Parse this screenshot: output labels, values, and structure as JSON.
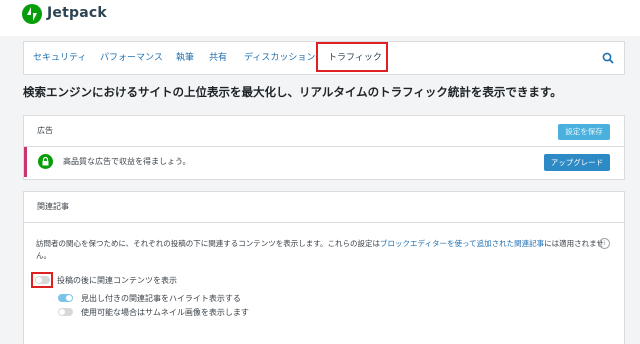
{
  "app": {
    "brand": "Jetpack"
  },
  "nav": {
    "tabs": [
      {
        "label": "セキュリティ"
      },
      {
        "label": "パフォーマンス"
      },
      {
        "label": "執筆"
      },
      {
        "label": "共有"
      },
      {
        "label": "ディスカッション"
      },
      {
        "label": "トラフィック",
        "active": true
      }
    ]
  },
  "headline": "検索エンジンにおけるサイトの上位表示を最大化し、リアルタイムのトラフィック統計を表示できます。",
  "ads": {
    "title": "広告",
    "save_label": "設定を保存",
    "promo_text": "高品質な広告で収益を得ましょう。",
    "upgrade_label": "アップグレード"
  },
  "related": {
    "title": "関連記事",
    "desc_before": "訪問者の関心を保つために、それぞれの投稿の下に関連するコンテンツを表示します。これらの設定は",
    "desc_link": "ブロックエディターを使って追加された関連記事",
    "desc_after": "には適用されません。",
    "info": "i",
    "main_toggle_label": "投稿の後に関連コンテンツを表示",
    "main_toggle_on": false,
    "options": [
      {
        "label": "見出し付きの関連記事をハイライト表示する",
        "on": true
      },
      {
        "label": "使用可能な場合はサムネイル画像を表示します",
        "on": false
      }
    ]
  },
  "colors": {
    "accent": "#2271b1",
    "brand": "#069e08",
    "highlight": "#e02020",
    "promo_border": "#c9356e"
  }
}
